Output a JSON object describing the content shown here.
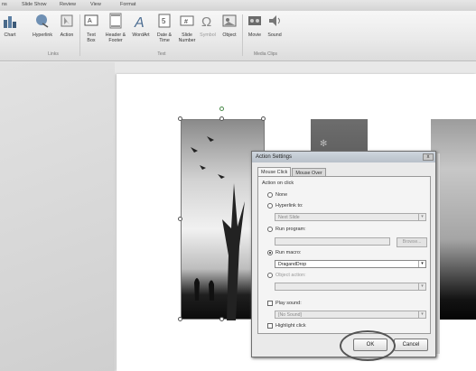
{
  "tabs": [
    "ns",
    "Slide Show",
    "Review",
    "View",
    "Format"
  ],
  "ribbon": {
    "buttons": [
      {
        "label": "Chart",
        "icon": "chart-icon"
      },
      {
        "label": "Hyperlink",
        "icon": "hyperlink-icon"
      },
      {
        "label": "Action",
        "icon": "action-icon"
      },
      {
        "label": "Text Box",
        "icon": "textbox-icon"
      },
      {
        "label": "Header & Footer",
        "icon": "header-footer-icon"
      },
      {
        "label": "WordArt",
        "icon": "wordart-icon"
      },
      {
        "label": "Date & Time",
        "icon": "date-time-icon"
      },
      {
        "label": "Slide Number",
        "icon": "slide-number-icon"
      },
      {
        "label": "Symbol",
        "icon": "symbol-icon"
      },
      {
        "label": "Object",
        "icon": "object-icon"
      },
      {
        "label": "Movie",
        "icon": "movie-icon"
      },
      {
        "label": "Sound",
        "icon": "sound-icon"
      }
    ],
    "groups": {
      "links": "Links",
      "text": "Text",
      "media": "Media Clips"
    }
  },
  "dialog": {
    "title": "Action Settings",
    "close": "x",
    "tabs": [
      "Mouse Click",
      "Mouse Over"
    ],
    "group_title": "Action on click",
    "options": {
      "none": "None",
      "hyperlink": "Hyperlink to:",
      "hyperlink_value": "Next Slide",
      "run_program": "Run program:",
      "browse": "Browse...",
      "run_macro": "Run macro:",
      "macro_value": "DragandDrop",
      "object_action": "Object action:",
      "play_sound": "Play sound:",
      "sound_value": "[No Sound]",
      "highlight": "Highlight click"
    },
    "ok": "OK",
    "cancel": "Cancel"
  }
}
